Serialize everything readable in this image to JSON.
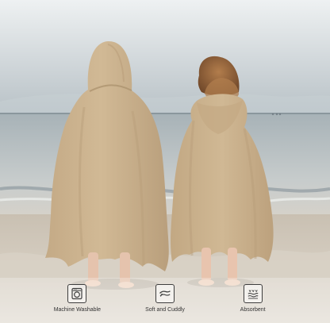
{
  "features": [
    {
      "label": "Machine Washable",
      "icon": "washing-machine-icon"
    },
    {
      "label": "Soft and Cuddly",
      "icon": "hand-icon"
    },
    {
      "label": "Absorbent",
      "icon": "water-absorb-icon"
    }
  ],
  "colors": {
    "towel": "#c9b08f",
    "sky": "#dbe2e6",
    "sand": "#d8cfc2",
    "sea": "#b8c0c3",
    "icon": "#3e3e3e"
  }
}
